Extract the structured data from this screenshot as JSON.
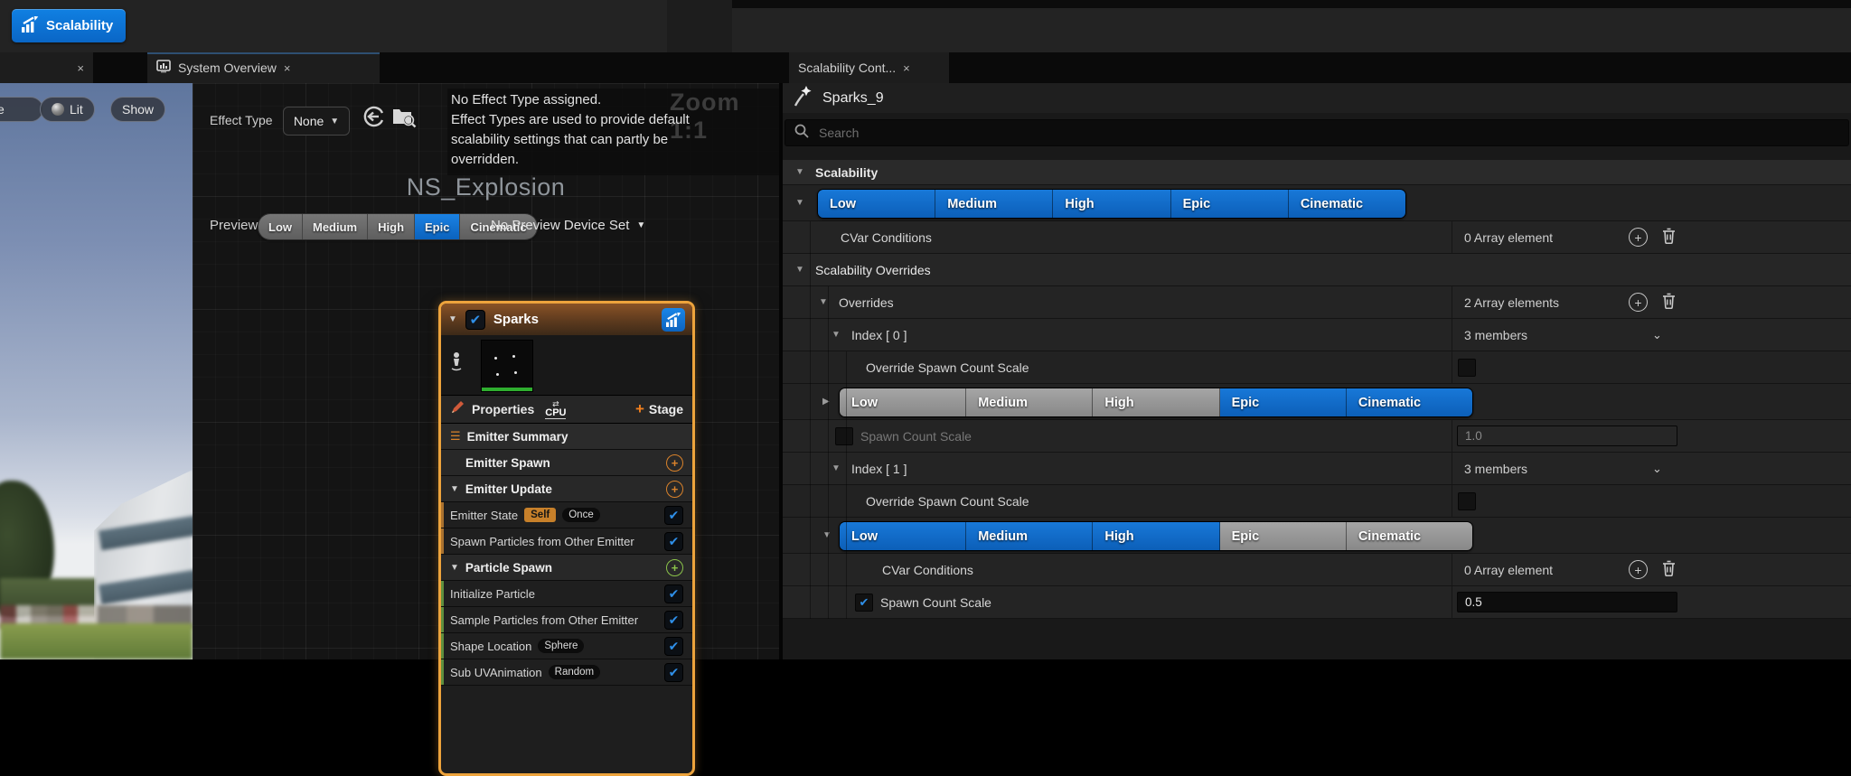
{
  "toolbar": {
    "scalability_label": "Scalability"
  },
  "tabs": {
    "system_overview": "System Overview",
    "scalability_content": "Scalability Cont...",
    "close": "×"
  },
  "viewport": {
    "perspective_label": "tive",
    "lit_label": "Lit",
    "show_label": "Show"
  },
  "graph": {
    "effect_type_label": "Effect Type",
    "effect_type_value": "None",
    "notice_line1": "No Effect Type assigned.",
    "notice_line2": "Effect Types are used to provide default",
    "notice_line3": "scalability settings that can partly be",
    "notice_line4": "overridden.",
    "zoom_indicator": "Zoom 1:1",
    "system_name": "NS_Explosion",
    "preview_label": "Preview",
    "device_set_label": "No Preview Device Set",
    "levels": [
      "Low",
      "Medium",
      "High",
      "Epic",
      "Cinematic"
    ],
    "preview_selected": "Epic"
  },
  "node": {
    "title": "Sparks",
    "properties_label": "Properties",
    "sim_target": "CPU",
    "stage_label": "Stage",
    "sections": {
      "emitter_summary": "Emitter Summary",
      "emitter_spawn": "Emitter Spawn",
      "emitter_update": "Emitter Update",
      "particle_spawn": "Particle Spawn"
    },
    "modules": {
      "emitter_state": "Emitter State",
      "emitter_state_badge1": "Self",
      "emitter_state_badge2": "Once",
      "spawn_particles": "Spawn Particles from Other Emitter",
      "initialize_particle": "Initialize Particle",
      "sample_particles": "Sample Particles from Other Emitter",
      "shape_location": "Shape Location",
      "shape_location_badge": "Sphere",
      "sub_uv": "Sub UVAnimation",
      "sub_uv_badge": "Random"
    }
  },
  "panel": {
    "title": "Sparks_9",
    "search_placeholder": "Search",
    "levels": [
      "Low",
      "Medium",
      "High",
      "Epic",
      "Cinematic"
    ],
    "scalability_section": "Scalability",
    "cvar_conditions_label": "CVar Conditions",
    "cvar_conditions_value": "0 Array element",
    "overrides_section": "Scalability Overrides",
    "overrides_label": "Overrides",
    "overrides_value": "2 Array elements",
    "index0_label": "Index [ 0 ]",
    "index0_members": "3 members",
    "override_scale_label": "Override Spawn Count Scale",
    "spawn_scale_label": "Spawn Count Scale",
    "index0_scale_value": "1.0",
    "index1_label": "Index [ 1 ]",
    "index1_members": "3 members",
    "index1_cvar_label": "CVar Conditions",
    "index1_cvar_value": "0 Array element",
    "index1_scale_value": "0.5"
  },
  "colors": {
    "accent_blue": "#0E6FD6",
    "selection_orange": "#EDA33C"
  }
}
